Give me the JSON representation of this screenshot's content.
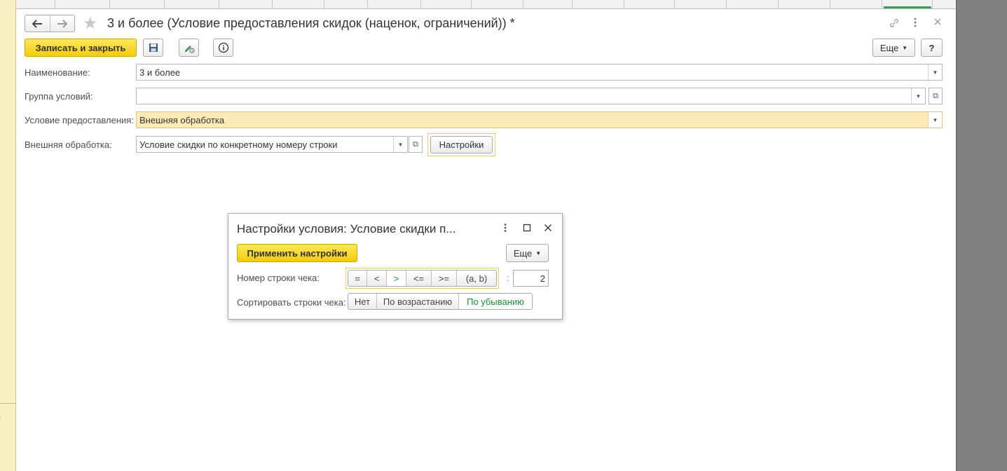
{
  "form": {
    "title": "3 и более (Условие предоставления скидок (наценок, ограничений)) *",
    "nav": {
      "back_icon": "arrow-left-icon",
      "forward_icon": "arrow-right-icon"
    },
    "toolbar": {
      "save_close_label": "Записать и закрыть",
      "more_label": "Еще",
      "help_label": "?"
    },
    "fields": {
      "name_label": "Наименование:",
      "name_value": "3 и более",
      "group_label": "Группа условий:",
      "group_value": "",
      "condition_label": "Условие предоставления:",
      "condition_value": "Внешняя обработка",
      "external_label": "Внешняя обработка:",
      "external_value": "Условие скидки по конкретному номеру строки",
      "settings_button": "Настройки"
    }
  },
  "dialog": {
    "title": "Настройки условия: Условие скидки п...",
    "apply_label": "Применить настройки",
    "more_label": "Еще",
    "row_number_label": "Номер строки чека:",
    "operators": [
      "=",
      "<",
      ">",
      "<=",
      ">=",
      "(a, b)"
    ],
    "selected_operator": ">",
    "colon": ":",
    "row_number_value": "2",
    "sort_label": "Сортировать строки чека:",
    "sort_options": [
      "Нет",
      "По возрастанию",
      "По убыванию"
    ],
    "selected_sort": "По убыванию"
  },
  "side": {
    "edge_glyph": ")"
  },
  "colors": {
    "accent_yellow": "#f3cc0c",
    "highlight_field": "#fce9b5",
    "selected_green": "#1e8c3a"
  }
}
